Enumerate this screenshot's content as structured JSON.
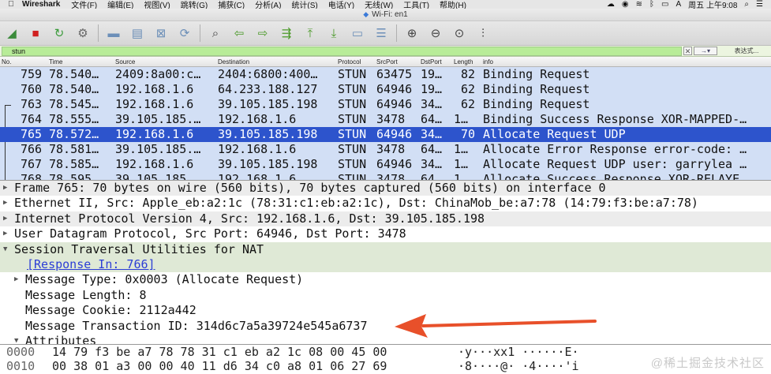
{
  "menubar": {
    "apple": "",
    "app": "Wireshark",
    "items": [
      "文件(F)",
      "编辑(E)",
      "视图(V)",
      "跳转(G)",
      "捕获(C)",
      "分析(A)",
      "统计(S)",
      "电话(Y)",
      "无线(W)",
      "工具(T)",
      "帮助(H)"
    ],
    "clock": "周五 上午9:08",
    "input_method": "A"
  },
  "window": {
    "title": "Wi-Fi: en1"
  },
  "filter": {
    "value": "stun",
    "expression_label": "表达式..."
  },
  "packet_list": {
    "columns": [
      "No.",
      "Time",
      "Source",
      "Destination",
      "Protocol",
      "SrcPort",
      "DstPort",
      "Length",
      "info"
    ],
    "rows": [
      {
        "no": "759",
        "time": "78.540…",
        "src": "2409:8a00:c…",
        "dst": "2404:6800:400…",
        "proto": "STUN",
        "sport": "63475",
        "dport": "19…",
        "len": "82",
        "info": "Binding Request"
      },
      {
        "no": "760",
        "time": "78.540…",
        "src": "192.168.1.6",
        "dst": "64.233.188.127",
        "proto": "STUN",
        "sport": "64946",
        "dport": "19…",
        "len": "62",
        "info": "Binding Request"
      },
      {
        "no": "763",
        "time": "78.545…",
        "src": "192.168.1.6",
        "dst": "39.105.185.198",
        "proto": "STUN",
        "sport": "64946",
        "dport": "34…",
        "len": "62",
        "info": "Binding Request"
      },
      {
        "no": "764",
        "time": "78.555…",
        "src": "39.105.185.…",
        "dst": "192.168.1.6",
        "proto": "STUN",
        "sport": "3478",
        "dport": "64…",
        "len": "1…",
        "info": "Binding Success Response XOR-MAPPED-…"
      },
      {
        "no": "765",
        "time": "78.572…",
        "src": "192.168.1.6",
        "dst": "39.105.185.198",
        "proto": "STUN",
        "sport": "64946",
        "dport": "34…",
        "len": "70",
        "info": "Allocate Request UDP"
      },
      {
        "no": "766",
        "time": "78.581…",
        "src": "39.105.185.…",
        "dst": "192.168.1.6",
        "proto": "STUN",
        "sport": "3478",
        "dport": "64…",
        "len": "1…",
        "info": "Allocate Error Response error-code: …"
      },
      {
        "no": "767",
        "time": "78.585…",
        "src": "192.168.1.6",
        "dst": "39.105.185.198",
        "proto": "STUN",
        "sport": "64946",
        "dport": "34…",
        "len": "1…",
        "info": "Allocate Request UDP user: garrylea …"
      },
      {
        "no": "768",
        "time": "78.595…",
        "src": "39.105.185.…",
        "dst": "192.168.1.6",
        "proto": "STUN",
        "sport": "3478",
        "dport": "64…",
        "len": "1…",
        "info": "Allocate Success Response XOR-RELAYE…"
      }
    ]
  },
  "details": {
    "lines": [
      "Frame 765: 70 bytes on wire (560 bits), 70 bytes captured (560 bits) on interface 0",
      "Ethernet II, Src: Apple_eb:a2:1c (78:31:c1:eb:a2:1c), Dst: ChinaMob_be:a7:78 (14:79:f3:be:a7:78)",
      "Internet Protocol Version 4, Src: 192.168.1.6, Dst: 39.105.185.198",
      "User Datagram Protocol, Src Port: 64946, Dst Port: 3478",
      "Session Traversal Utilities for NAT",
      "[Response In: 766]",
      "Message Type: 0x0003 (Allocate Request)",
      "Message Length: 8",
      "Message Cookie: 2112a442",
      "Message Transaction ID: 314d6c7a5a39724e545a6737",
      "Attributes"
    ]
  },
  "bytes": {
    "rows": [
      {
        "offset": "0000",
        "hex": "14 79 f3 be a7 78 78 31  c1 eb a2 1c 08 00 45 00",
        "ascii": "·y···xx1 ······E·"
      },
      {
        "offset": "0010",
        "hex": "00 38 01 a3 00 00 40 11  d6 34 c0 a8 01 06 27 69",
        "ascii": "·8····@· ·4····'i"
      }
    ]
  },
  "watermark": "@稀土掘金技术社区",
  "colors": {
    "selected_row": "#2d54cc",
    "list_bg": "#d2dff5",
    "filter_ok": "#b8ec98",
    "arrow": "#e8502a"
  }
}
